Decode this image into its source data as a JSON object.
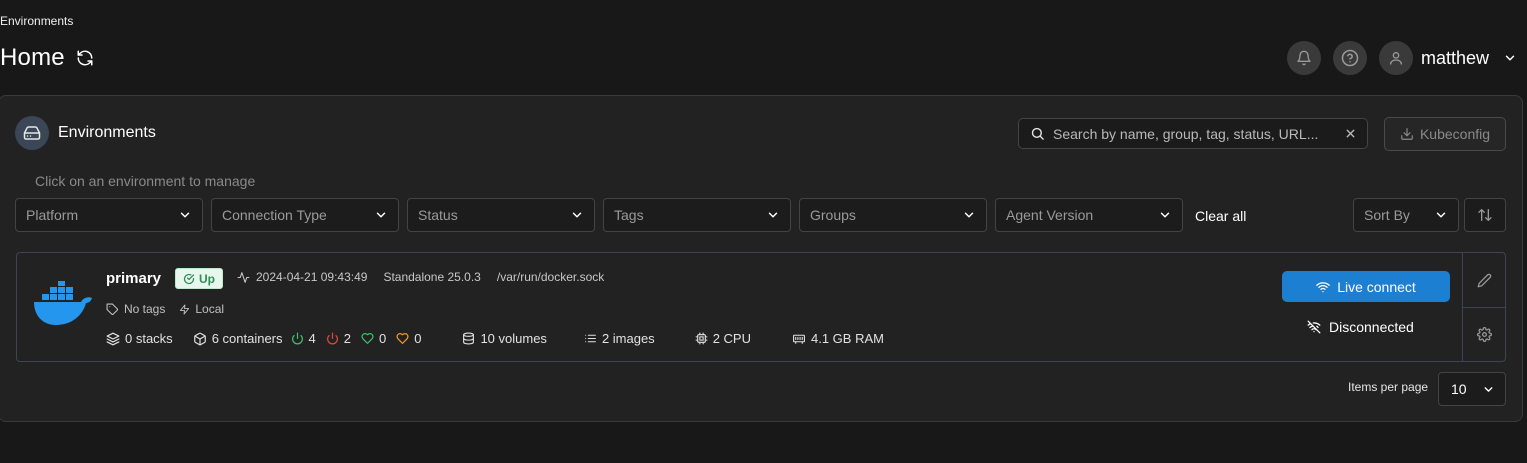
{
  "breadcrumb": "Environments",
  "page_title": "Home",
  "user": {
    "name": "matthew"
  },
  "panel": {
    "title": "Environments",
    "search_placeholder": "Search by name, group, tag, status, URL...",
    "kubeconfig_label": "Kubeconfig",
    "hint": "Click on an environment to manage",
    "filters": [
      "Platform",
      "Connection Type",
      "Status",
      "Tags",
      "Groups",
      "Agent Version"
    ],
    "clear_all": "Clear all",
    "sort_by": "Sort By"
  },
  "environment": {
    "name": "primary",
    "status": "Up",
    "timestamp": "2024-04-21 09:43:49",
    "type": "Standalone 25.0.3",
    "url": "/var/run/docker.sock",
    "tags": "No tags",
    "location": "Local",
    "stacks": "0 stacks",
    "containers": "6 containers",
    "running": "4",
    "stopped": "2",
    "healthy": "0",
    "unhealthy": "0",
    "volumes": "10 volumes",
    "images": "2 images",
    "cpu": "2 CPU",
    "ram": "4.1 GB RAM",
    "live_connect": "Live connect",
    "connection_status": "Disconnected"
  },
  "pagination": {
    "label": "Items per page",
    "value": "10"
  },
  "colors": {
    "accent": "#1d7fd1",
    "running": "#3ec46d",
    "stopped": "#e04a3f",
    "healthy": "#3ec46d",
    "unhealthy": "#f39c2c",
    "docker": "#2496ed"
  }
}
